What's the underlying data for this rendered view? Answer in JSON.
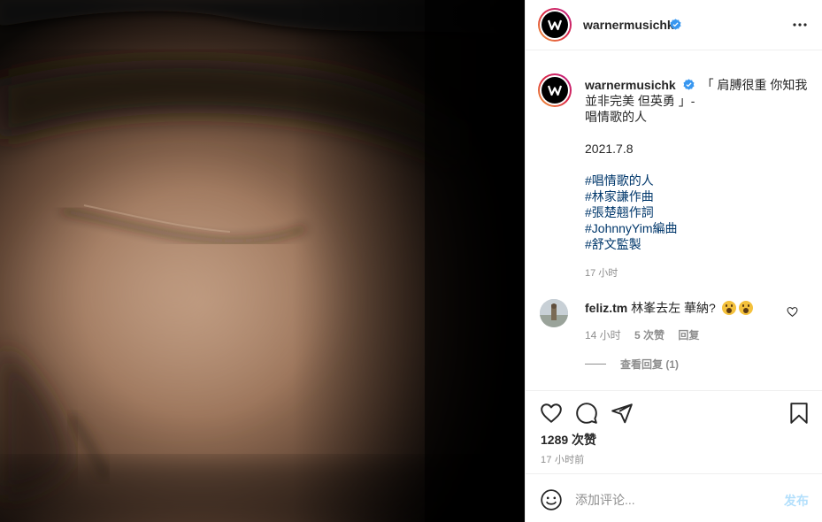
{
  "post": {
    "username": "warnermusichk",
    "avatar_logo": "W",
    "verified": true,
    "caption": {
      "lines": [
        "「 肩膊很重 你知我",
        "並非完美 但英勇 」-",
        "唱情歌的人"
      ],
      "date": "2021.7.8",
      "hashtags": [
        "#唱情歌的人",
        "#林家謙作曲",
        "#張楚翹作詞",
        "#JohnnyYim編曲",
        "#舒文監製"
      ],
      "time": "17 小时"
    },
    "comment": {
      "username": "feliz.tm",
      "text": "林峯去左 華納?",
      "emoji_count": 2,
      "time": "14 小时",
      "likes": "5 次赞",
      "reply_label": "回复",
      "view_replies": "查看回复 (1)"
    },
    "likes": "1289 次赞",
    "posted": "17 小时前",
    "add_comment": {
      "placeholder": "添加评论...",
      "post_label": "发布"
    }
  },
  "icons": {
    "more": "more-horizontal-icon",
    "verified": "verified-badge-icon",
    "like": "heart-icon",
    "comment": "comment-bubble-icon",
    "share": "paper-plane-icon",
    "save": "bookmark-icon",
    "emoji": "smile-icon"
  },
  "colors": {
    "hashtag": "#00376b",
    "verified": "#3897f0",
    "muted": "#8e8e8e",
    "post_button_disabled": "#b2dffc"
  }
}
